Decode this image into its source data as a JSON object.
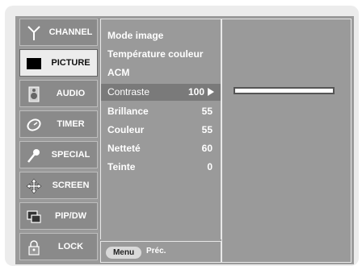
{
  "menu": {
    "items": [
      {
        "label": "CHANNEL",
        "icon": "antenna-icon"
      },
      {
        "label": "PICTURE",
        "icon": "picture-icon"
      },
      {
        "label": "AUDIO",
        "icon": "speaker-icon"
      },
      {
        "label": "TIMER",
        "icon": "clock-icon"
      },
      {
        "label": "SPECIAL",
        "icon": "key-icon"
      },
      {
        "label": "SCREEN",
        "icon": "move-arrows-icon"
      },
      {
        "label": "PIP/DW",
        "icon": "pip-icon"
      },
      {
        "label": "LOCK",
        "icon": "padlock-icon"
      }
    ],
    "active": "PICTURE"
  },
  "submenu": {
    "items": [
      {
        "name": "Mode image",
        "value": ""
      },
      {
        "name": "Température couleur",
        "value": ""
      },
      {
        "name": "ACM",
        "value": ""
      },
      {
        "name": "Contraste",
        "value": "100"
      },
      {
        "name": "Brillance",
        "value": "55"
      },
      {
        "name": "Couleur",
        "value": "55"
      },
      {
        "name": "Netteté",
        "value": "60"
      },
      {
        "name": "Teinte",
        "value": "0"
      }
    ],
    "selected": "Contraste"
  },
  "footer": {
    "menu_button": "Menu",
    "prev_label": "Préc."
  },
  "slider": {
    "setting": "Contraste",
    "value": 100,
    "max": 100
  },
  "colors": {
    "screen_bg": "#9a9a9a",
    "active_item_bg": "#ececec",
    "selected_row_bg": "#7a7a7a"
  }
}
